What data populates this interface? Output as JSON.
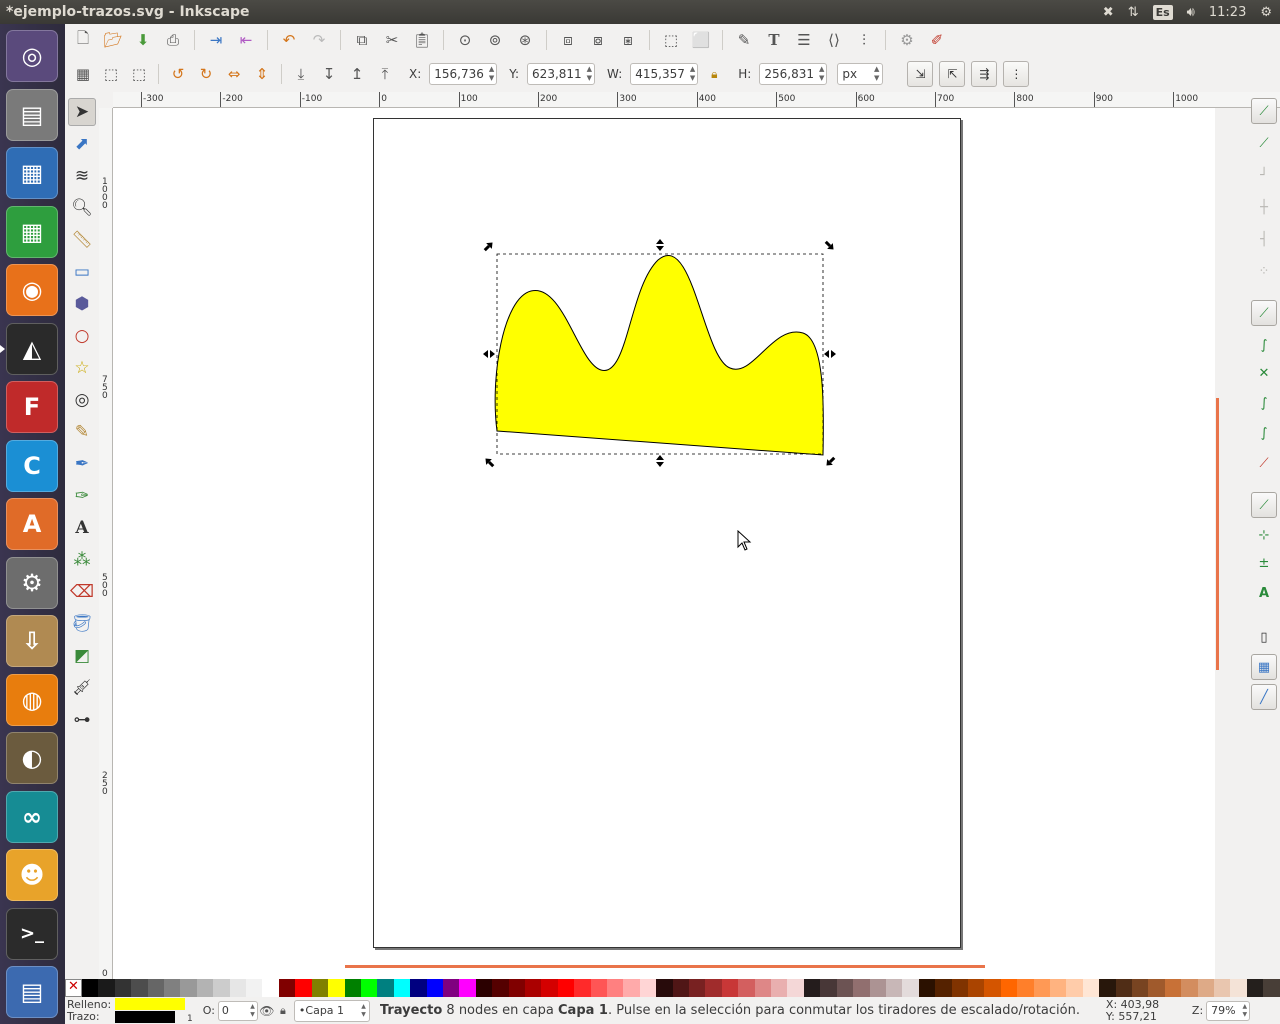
{
  "window": {
    "title": "*ejemplo-trazos.svg - Inkscape"
  },
  "top_panel": {
    "keyboard": "Es",
    "clock": "11:23"
  },
  "launcher": {
    "items": [
      {
        "name": "ubuntu-dash",
        "glyph": "◎",
        "color": "#5a4a7c"
      },
      {
        "name": "files",
        "glyph": "▤",
        "color": "#7a7a7a"
      },
      {
        "name": "libreoffice-writer",
        "glyph": "▦",
        "color": "#2f6db5"
      },
      {
        "name": "libreoffice-calc",
        "glyph": "▦",
        "color": "#2e9e3e"
      },
      {
        "name": "firefox",
        "glyph": "◉",
        "color": "#e8711a"
      },
      {
        "name": "inkscape",
        "glyph": "◭",
        "color": "#2a2a2a"
      },
      {
        "name": "freecad",
        "glyph": "F",
        "color": "#c02a2a"
      },
      {
        "name": "codeblocks",
        "glyph": "C",
        "color": "#1b8fd4"
      },
      {
        "name": "software-center",
        "glyph": "A",
        "color": "#e06b28"
      },
      {
        "name": "system-settings",
        "glyph": "⚙",
        "color": "#6d6d6d"
      },
      {
        "name": "archive-manager",
        "glyph": "⇩",
        "color": "#b08a52"
      },
      {
        "name": "blender",
        "glyph": "◍",
        "color": "#e87d0d"
      },
      {
        "name": "gimp",
        "glyph": "◐",
        "color": "#6b5b3e"
      },
      {
        "name": "arduino",
        "glyph": "∞",
        "color": "#168c94"
      },
      {
        "name": "scratch",
        "glyph": "☻",
        "color": "#e8a32a"
      },
      {
        "name": "terminal",
        "glyph": ">_",
        "color": "#2b2b2b"
      },
      {
        "name": "workspaces",
        "glyph": "▤",
        "color": "#3c6ab0"
      }
    ]
  },
  "toolbar": {
    "x_label": "X:",
    "x_value": "156,736",
    "y_label": "Y:",
    "y_value": "623,811",
    "w_label": "W:",
    "w_value": "415,357",
    "h_label": "H:",
    "h_value": "256,831",
    "unit": "px"
  },
  "rulers": {
    "horizontal": [
      "-300",
      "-200",
      "-100",
      "0",
      "100",
      "200",
      "300",
      "400",
      "500",
      "600",
      "700",
      "800",
      "900",
      "1000"
    ],
    "vertical": [
      "1000",
      "750",
      "500",
      "250",
      "0"
    ]
  },
  "statusbar": {
    "fill_label": "Relleno:",
    "stroke_label": "Trazo:",
    "fill_color": "#ffff00",
    "stroke_color": "#000000",
    "stroke_width": "1",
    "opacity_label": "O:",
    "opacity_value": "0",
    "layer": "•Capa 1",
    "msg_object": "Trayecto",
    "msg_nodes": " 8 nodes en capa ",
    "msg_layer": "Capa 1",
    "msg_rest": ". Pulse en la selección para conmutar los tiradores de escalado/rotación.",
    "coord_x": "X: 403,98",
    "coord_y": "Y: 557,21",
    "zoom_label": "Z:",
    "zoom_value": "79%"
  },
  "shape": {
    "fill": "#ffff00",
    "stroke": "#000000"
  },
  "palette": [
    "#000000",
    "#1a1a1a",
    "#333333",
    "#4d4d4d",
    "#666666",
    "#808080",
    "#999999",
    "#b3b3b3",
    "#cccccc",
    "#e6e6e6",
    "#f2f2f2",
    "#ffffff",
    "#800000",
    "#ff0000",
    "#808000",
    "#ffff00",
    "#008000",
    "#00ff00",
    "#008080",
    "#00ffff",
    "#000080",
    "#0000ff",
    "#800080",
    "#ff00ff",
    "#2b0000",
    "#550000",
    "#800000",
    "#aa0000",
    "#d40000",
    "#ff0000",
    "#ff2a2a",
    "#ff5555",
    "#ff8080",
    "#ffaaaa",
    "#ffd5d5",
    "#280b0b",
    "#501616",
    "#782121",
    "#a02c2c",
    "#c83737",
    "#d35f5f",
    "#de8787",
    "#e9afaf",
    "#f4d7d7",
    "#241c1c",
    "#483737",
    "#6c5353",
    "#916f6f",
    "#ac9393",
    "#c8b7b7",
    "#e3dbdb",
    "#2b1100",
    "#552200",
    "#803300",
    "#aa4400",
    "#d45500",
    "#ff6600",
    "#ff7f2a",
    "#ff9955",
    "#ffb380",
    "#ffccaa",
    "#ffe6d5",
    "#28170b",
    "#502d16",
    "#784421",
    "#a05a2c",
    "#c87137",
    "#d38d5f",
    "#deaa87",
    "#e9c6af",
    "#f4e3d7",
    "#241f1c",
    "#483e37"
  ]
}
